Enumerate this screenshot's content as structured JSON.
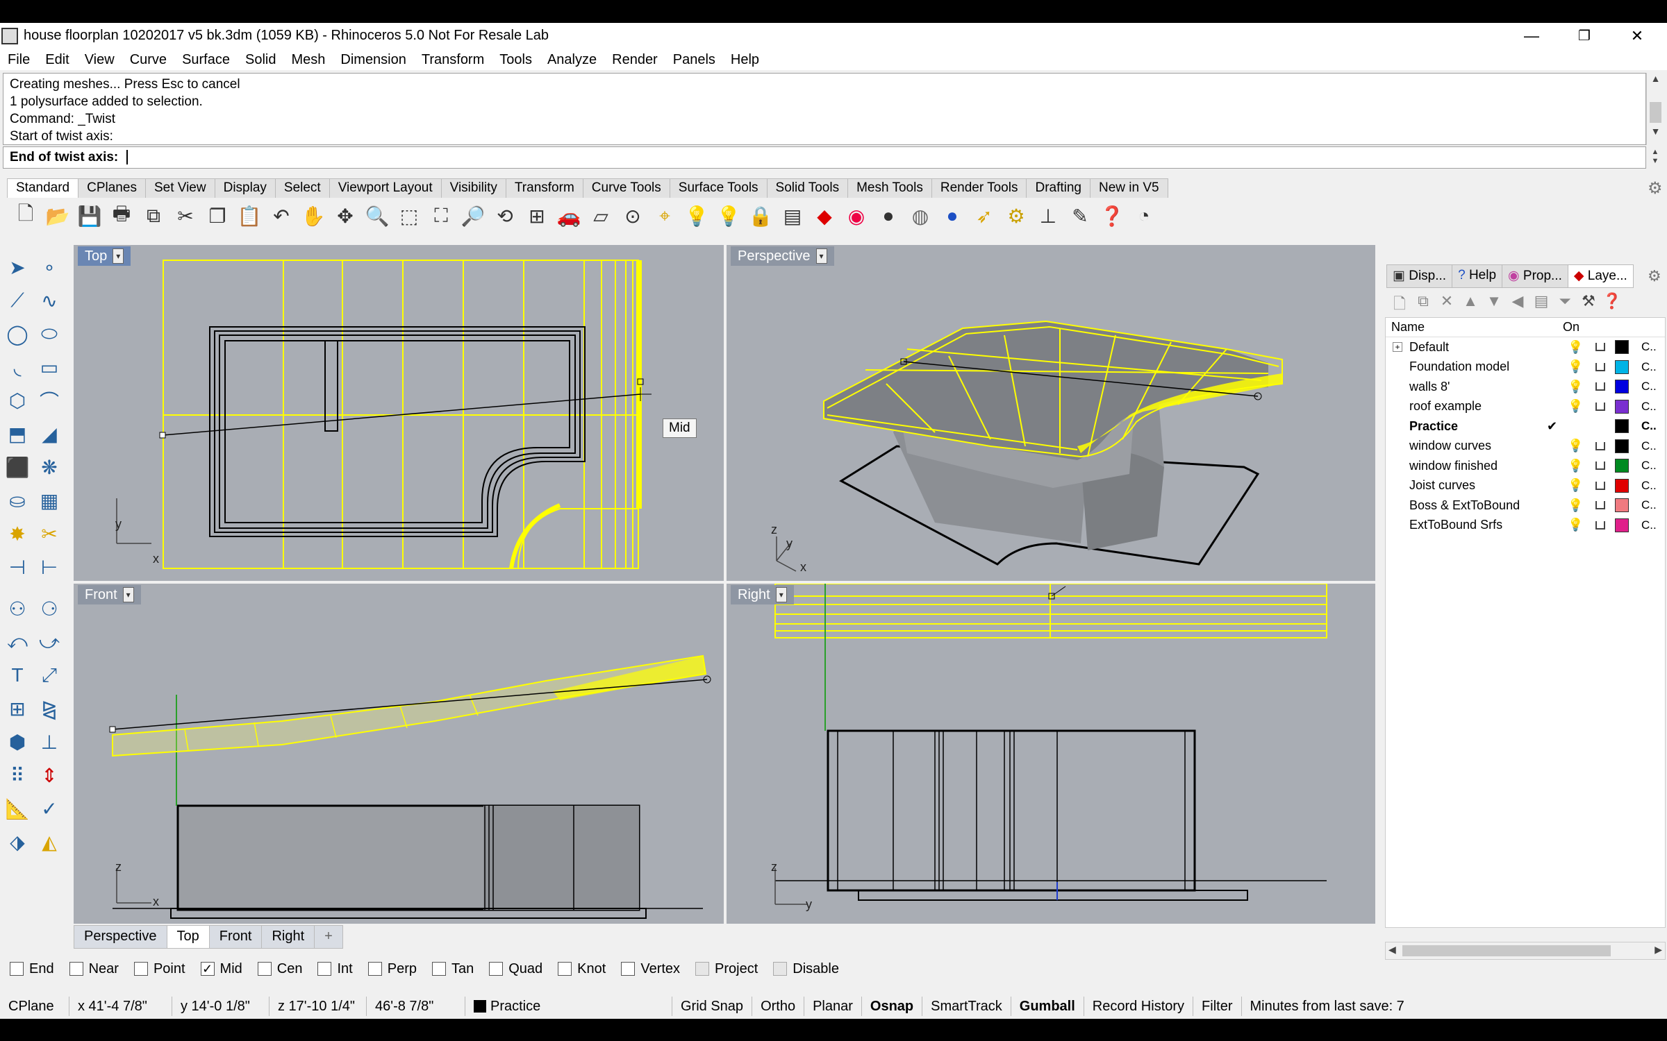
{
  "window": {
    "title": "house floorplan 10202017 v5 bk.3dm (1059 KB) - Rhinoceros 5.0 Not For Resale Lab",
    "minimize": "—",
    "restore": "❐",
    "close": "✕"
  },
  "menu": [
    "File",
    "Edit",
    "View",
    "Curve",
    "Surface",
    "Solid",
    "Mesh",
    "Dimension",
    "Transform",
    "Tools",
    "Analyze",
    "Render",
    "Panels",
    "Help"
  ],
  "command": {
    "history": [
      "Creating meshes... Press Esc to cancel",
      "1 polysurface added to selection.",
      "Command: _Twist",
      "Start of twist axis:"
    ],
    "prompt": "End of twist axis:"
  },
  "toolbar_tabs": [
    "Standard",
    "CPlanes",
    "Set View",
    "Display",
    "Select",
    "Viewport Layout",
    "Visibility",
    "Transform",
    "Curve Tools",
    "Surface Tools",
    "Solid Tools",
    "Mesh Tools",
    "Render Tools",
    "Drafting",
    "New in V5"
  ],
  "viewports": {
    "top": {
      "label": "Top",
      "tooltip": "Mid",
      "axis_x": "x",
      "axis_y": "y"
    },
    "perspective": {
      "label": "Perspective",
      "axis_x": "x",
      "axis_y": "y",
      "axis_z": "z"
    },
    "front": {
      "label": "Front",
      "axis_x": "x",
      "axis_z": "z"
    },
    "right": {
      "label": "Right",
      "axis_y": "y",
      "axis_z": "z"
    }
  },
  "view_tabs": [
    "Perspective",
    "Top",
    "Front",
    "Right",
    "+"
  ],
  "osnap": [
    {
      "label": "End",
      "checked": false
    },
    {
      "label": "Near",
      "checked": false
    },
    {
      "label": "Point",
      "checked": false
    },
    {
      "label": "Mid",
      "checked": true
    },
    {
      "label": "Cen",
      "checked": false
    },
    {
      "label": "Int",
      "checked": false
    },
    {
      "label": "Perp",
      "checked": false
    },
    {
      "label": "Tan",
      "checked": false
    },
    {
      "label": "Quad",
      "checked": false
    },
    {
      "label": "Knot",
      "checked": false
    },
    {
      "label": "Vertex",
      "checked": false
    },
    {
      "label": "Project",
      "checked": false
    },
    {
      "label": "Disable",
      "checked": false
    }
  ],
  "status": {
    "cplane": "CPlane",
    "x": "x 41'-4 7/8\"",
    "y": "y 14'-0 1/8\"",
    "z": "z 17'-10 1/4\"",
    "dist": "46'-8 7/8\"",
    "layer": "Practice",
    "toggles": [
      "Grid Snap",
      "Ortho",
      "Planar",
      "Osnap",
      "SmartTrack",
      "Gumball",
      "Record History",
      "Filter"
    ],
    "bold_toggles": [
      "Osnap",
      "Gumball"
    ],
    "save": "Minutes from last save: 7"
  },
  "panel": {
    "tabs": [
      "Disp...",
      "Help",
      "Prop...",
      "Laye..."
    ],
    "col_name": "Name",
    "col_on": "On",
    "layers": [
      {
        "name": "Default",
        "color": "#000000",
        "current": false,
        "bulb": "#f2c200",
        "expander": true
      },
      {
        "name": "Foundation model",
        "color": "#00b4e6",
        "current": false,
        "bulb": "#1e90ff"
      },
      {
        "name": "walls 8'",
        "color": "#0000e0",
        "current": false,
        "bulb": "#1e90ff"
      },
      {
        "name": "roof example",
        "color": "#7a2fd0",
        "current": false,
        "bulb": "#1e90ff"
      },
      {
        "name": "Practice",
        "color": "#000000",
        "current": true,
        "bulb": ""
      },
      {
        "name": "window curves",
        "color": "#000000",
        "current": false,
        "bulb": "#1e90ff"
      },
      {
        "name": "window finished",
        "color": "#008a20",
        "current": false,
        "bulb": "#1e90ff"
      },
      {
        "name": "Joist curves",
        "color": "#e00000",
        "current": false,
        "bulb": "#1e90ff"
      },
      {
        "name": "Boss & ExtToBound",
        "color": "#f07a80",
        "current": false,
        "bulb": "#1e90ff"
      },
      {
        "name": "ExtToBound Srfs",
        "color": "#e0208a",
        "current": false,
        "bulb": "#1e90ff"
      }
    ],
    "mat_text": "C..",
    "check": "✔"
  }
}
